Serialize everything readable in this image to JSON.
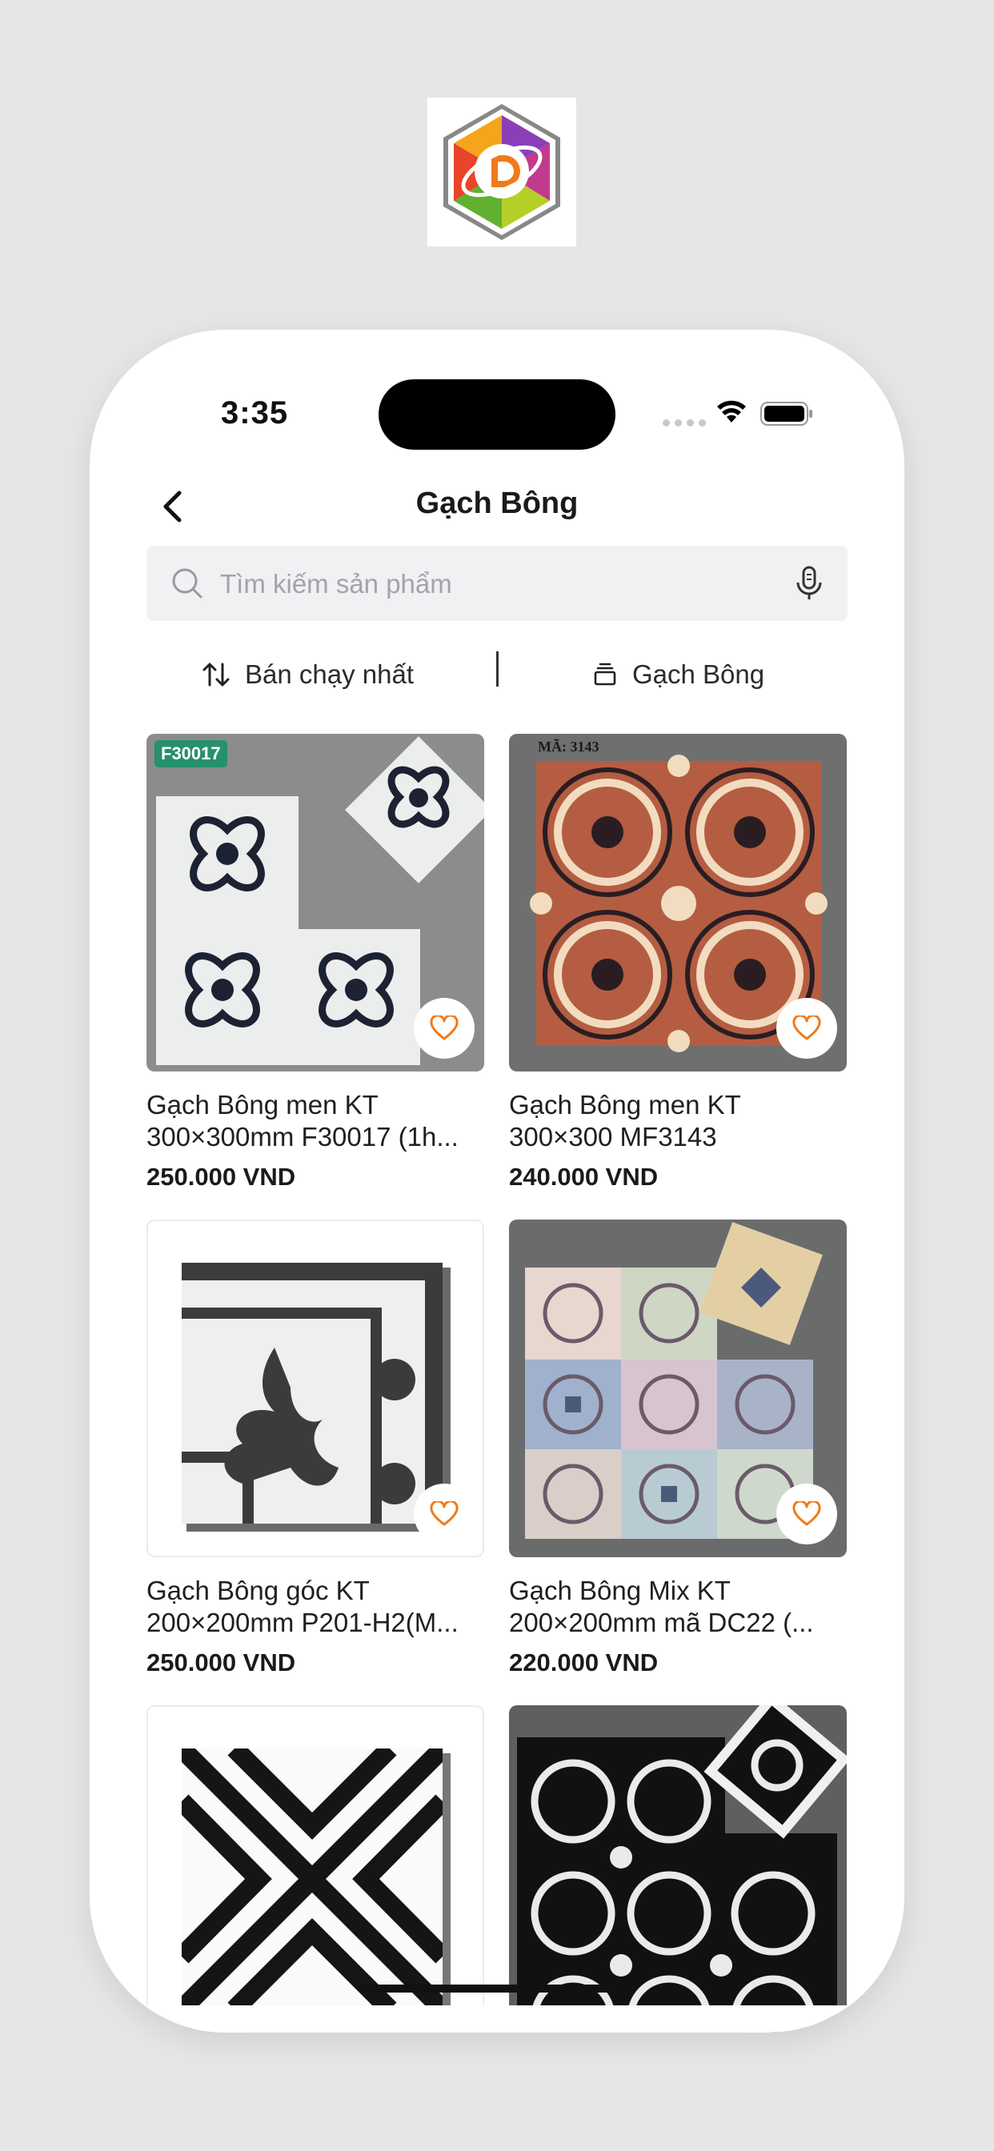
{
  "status_bar": {
    "time": "3:35"
  },
  "header": {
    "title": "Gạch Bông"
  },
  "search": {
    "placeholder": "Tìm kiếm sản phẩm"
  },
  "filters": {
    "sort_label": "Bán chạy nhất",
    "category_label": "Gạch Bông"
  },
  "colors": {
    "accent": "#f07a1a",
    "badge": "#27906c"
  },
  "products": [
    {
      "name": "Gạch Bông men KT 300×300mm F30017 (1h...",
      "price": "250.000 VND",
      "badge": "F30017"
    },
    {
      "name": "Gạch Bông men KT 300×300 MF3143",
      "price": "240.000 VND",
      "image_text": "MÃ: 3143"
    },
    {
      "name": "Gạch Bông góc KT 200×200mm P201-H2(M...",
      "price": "250.000 VND"
    },
    {
      "name": "Gạch Bông Mix KT 200×200mm mã DC22 (...",
      "price": "220.000 VND"
    },
    {
      "name": "",
      "price": ""
    },
    {
      "name": "",
      "price": ""
    }
  ]
}
